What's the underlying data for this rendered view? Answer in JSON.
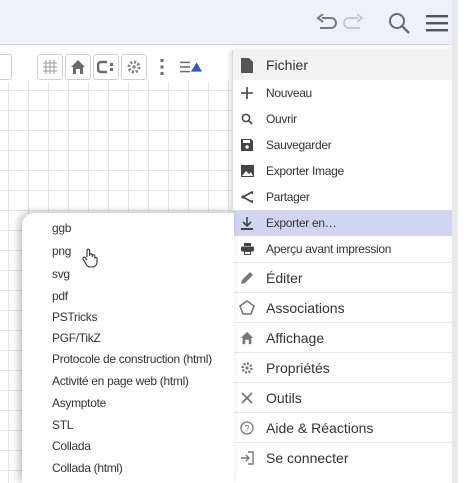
{
  "header": {
    "undo_icon": "undo-icon",
    "redo_icon": "redo-icon",
    "search_icon": "search-icon",
    "menu_icon": "hamburger-menu-icon"
  },
  "toolbar": {
    "icons": [
      "grid-icon",
      "home-icon",
      "point-capture-icon",
      "settings-icon",
      "more-vertical-icon",
      "style-bar-toggle-icon"
    ]
  },
  "menu": {
    "file_header": "Fichier",
    "file_items": [
      {
        "icon": "plus-icon",
        "label": "Nouveau"
      },
      {
        "icon": "search-icon",
        "label": "Ouvrir"
      },
      {
        "icon": "save-icon",
        "label": "Sauvegarder"
      },
      {
        "icon": "image-icon",
        "label": "Exporter Image"
      },
      {
        "icon": "share-icon",
        "label": "Partager"
      },
      {
        "icon": "download-icon",
        "label": "Exporter en…",
        "selected": true
      },
      {
        "icon": "print-icon",
        "label": "Aperçu avant impression"
      }
    ],
    "top_items": [
      {
        "icon": "pencil-icon",
        "label": "Éditer"
      },
      {
        "icon": "associations-icon",
        "label": "Associations"
      },
      {
        "icon": "home-icon",
        "label": "Affichage"
      },
      {
        "icon": "gear-icon",
        "label": "Propriétés"
      },
      {
        "icon": "tools-icon",
        "label": "Outils"
      },
      {
        "icon": "help-icon",
        "label": "Aide & Réactions"
      },
      {
        "icon": "sign-in-icon",
        "label": "Se connecter"
      }
    ]
  },
  "export_submenu": {
    "items": [
      "ggb",
      "png",
      "svg",
      "pdf",
      "PSTricks",
      "PGF/TikZ",
      "Protocole de construction (html)",
      "Activité en page web (html)",
      "Asymptote",
      "STL",
      "Collada",
      "Collada (html)"
    ]
  },
  "colors": {
    "header_bg": "#eef1fa",
    "selected_bg": "#d0d5f2",
    "accent_blue": "#3b59c6"
  }
}
